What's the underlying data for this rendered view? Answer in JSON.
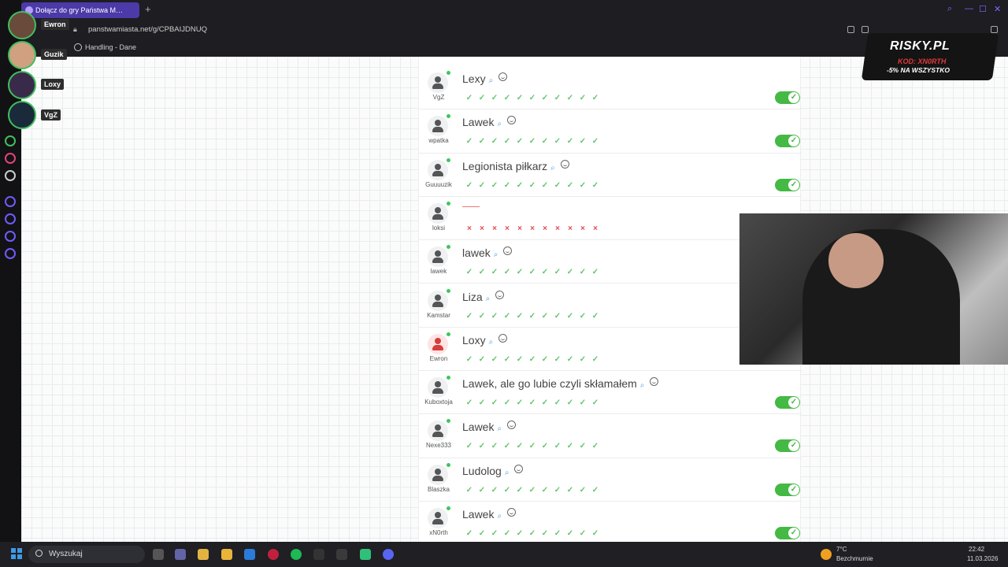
{
  "browser": {
    "tab_title": "Dołącz do gry Państwa M…",
    "url": "panstwamiasta.net/g/CPBAIJDNUQ",
    "bookmark": "Handling - Dane"
  },
  "stream_overlay": {
    "players": [
      "Ewron",
      "Guzik",
      "Loxy",
      "VgZ"
    ],
    "promo_title": "RISKY.PL",
    "promo_code": "KOD: XN0RTH",
    "promo_sub": "-5% NA WSZYSTKO"
  },
  "answers": [
    {
      "answer": "Lexy",
      "player": "VgZ",
      "valid": true,
      "toggle": true
    },
    {
      "answer": "Lawek",
      "player": "wpatka",
      "valid": true,
      "toggle": true
    },
    {
      "answer": "Legionista piłkarz",
      "player": "Guuuuzik",
      "valid": true,
      "toggle": true
    },
    {
      "answer": "",
      "player": "loksi",
      "valid": false,
      "toggle": false
    },
    {
      "answer": "lawek",
      "player": "lawek",
      "valid": true,
      "toggle": false
    },
    {
      "answer": "Liza",
      "player": "Kamstar",
      "valid": true,
      "toggle": false
    },
    {
      "answer": "Loxy",
      "player": "Ewron",
      "valid": true,
      "toggle": false
    },
    {
      "answer": "Lawek, ale go lubie czyli skłamałem",
      "player": "Kuboxtoja",
      "valid": true,
      "toggle": true
    },
    {
      "answer": "Lawek",
      "player": "Nexe333",
      "valid": true,
      "toggle": true
    },
    {
      "answer": "Ludolog",
      "player": "Blaszka",
      "valid": true,
      "toggle": true
    },
    {
      "answer": "Lawek",
      "player": "xN0rth",
      "valid": true,
      "toggle": true
    }
  ],
  "marks": {
    "ok": "✓",
    "bad": "×",
    "count": 11
  },
  "taskbar": {
    "search_placeholder": "Wyszukaj",
    "temperature": "7°C",
    "weather": "Bezchmurnie",
    "time": "22:42",
    "date": "11.03.2026"
  },
  "colors": {
    "toggle_on": "#44b944",
    "valid": "#62c46a",
    "invalid": "#e24b4b",
    "accent": "#4b3aa8"
  }
}
